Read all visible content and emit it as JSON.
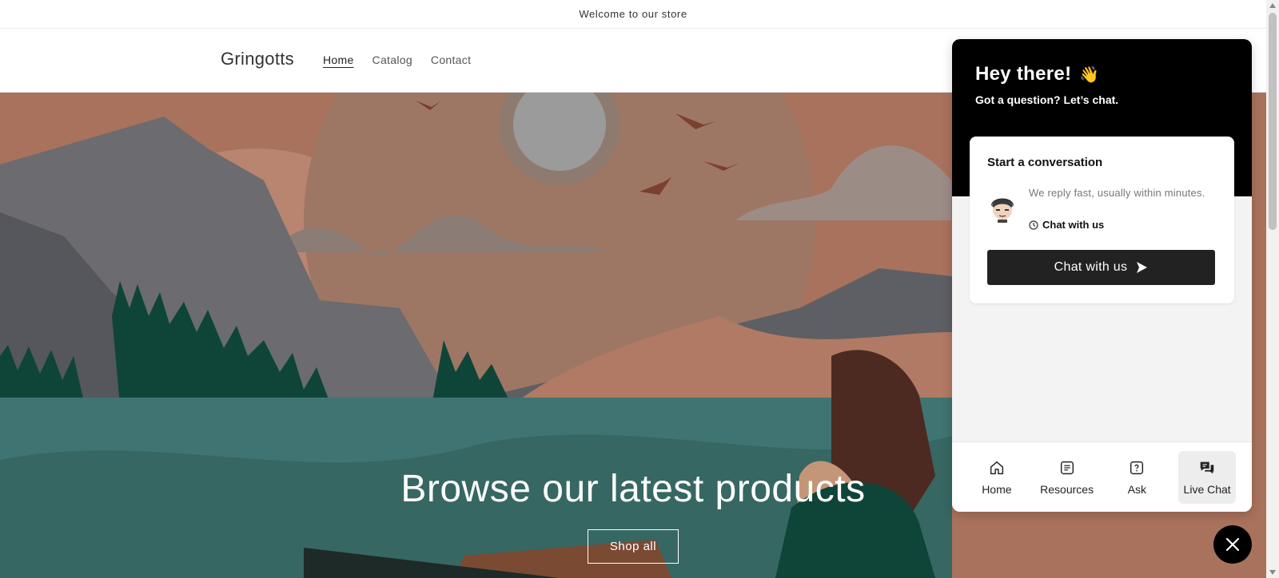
{
  "announcement": {
    "text": "Welcome to our store"
  },
  "header": {
    "logo": "Gringotts",
    "nav": [
      {
        "label": "Home",
        "active": true
      },
      {
        "label": "Catalog",
        "active": false
      },
      {
        "label": "Contact",
        "active": false
      }
    ]
  },
  "hero": {
    "title": "Browse our latest products",
    "button_label": "Shop all"
  },
  "chat": {
    "greeting": "Hey there!",
    "greeting_emoji": "👋",
    "subtitle": "Got a question? Let’s chat.",
    "card_title": "Start a conversation",
    "reply_text": "We reply fast, usually within minutes.",
    "link_label": "Chat with us",
    "button_label": "Chat with us",
    "tabs": [
      {
        "label": "Home",
        "icon": "home-icon",
        "active": false
      },
      {
        "label": "Resources",
        "icon": "document-icon",
        "active": false
      },
      {
        "label": "Ask",
        "icon": "question-icon",
        "active": false
      },
      {
        "label": "Live Chat",
        "icon": "chat-bubbles-icon",
        "active": true
      }
    ]
  },
  "colors": {
    "chat_header_bg": "#000000",
    "chat_button_bg": "#222222",
    "hero_water": "#3f7472",
    "hero_sky": "#b5806a"
  }
}
